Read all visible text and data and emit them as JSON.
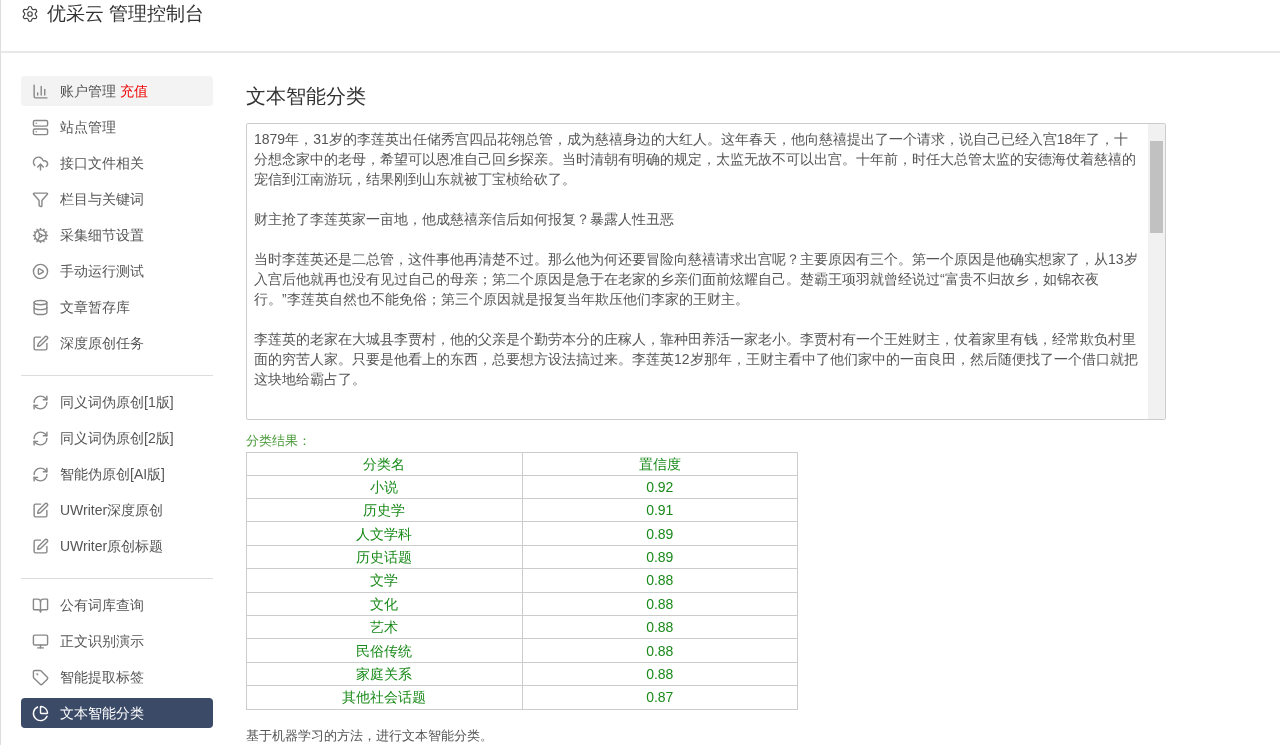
{
  "header": {
    "title": "优采云 管理控制台"
  },
  "sidebar": {
    "groups": [
      {
        "items": [
          {
            "label": "账户管理",
            "tag": "充值",
            "selected": false,
            "highlighted": true
          },
          {
            "label": "站点管理",
            "selected": false,
            "highlighted": false
          },
          {
            "label": "接口文件相关",
            "selected": false,
            "highlighted": false
          },
          {
            "label": "栏目与关键词",
            "selected": false,
            "highlighted": false
          },
          {
            "label": "采集细节设置",
            "selected": false,
            "highlighted": false
          },
          {
            "label": "手动运行测试",
            "selected": false,
            "highlighted": false
          },
          {
            "label": "文章暂存库",
            "selected": false,
            "highlighted": false
          },
          {
            "label": "深度原创任务",
            "selected": false,
            "highlighted": false
          }
        ]
      },
      {
        "items": [
          {
            "label": "同义词伪原创[1版]",
            "selected": false,
            "highlighted": false
          },
          {
            "label": "同义词伪原创[2版]",
            "selected": false,
            "highlighted": false
          },
          {
            "label": "智能伪原创[AI版]",
            "selected": false,
            "highlighted": false
          },
          {
            "label": "UWriter深度原创",
            "selected": false,
            "highlighted": false
          },
          {
            "label": "UWriter原创标题",
            "selected": false,
            "highlighted": false
          }
        ]
      },
      {
        "items": [
          {
            "label": "公有词库查询",
            "selected": false,
            "highlighted": false
          },
          {
            "label": "正文识别演示",
            "selected": false,
            "highlighted": false
          },
          {
            "label": "智能提取标签",
            "selected": false,
            "highlighted": false
          },
          {
            "label": "文本智能分类",
            "selected": true,
            "highlighted": false
          }
        ]
      }
    ]
  },
  "main": {
    "title": "文本智能分类",
    "text_input": {
      "paragraphs": [
        "1879年，31岁的李莲英出任储秀宫四品花翎总管，成为慈禧身边的大红人。这年春天，他向慈禧提出了一个请求，说自己已经入宫18年了，十分想念家中的老母，希望可以恩准自己回乡探亲。当时清朝有明确的规定，太监无故不可以出宫。十年前，时任大总管太监的安德海仗着慈禧的宠信到江南游玩，结果刚到山东就被丁宝桢给砍了。",
        "财主抢了李莲英家一亩地，他成慈禧亲信后如何报复？暴露人性丑恶",
        "当时李莲英还是二总管，这件事他再清楚不过。那么他为何还要冒险向慈禧请求出宫呢？主要原因有三个。第一个原因是他确实想家了，从13岁入宫后他就再也没有见过自己的母亲；第二个原因是急于在老家的乡亲们面前炫耀自己。楚霸王项羽就曾经说过“富贵不归故乡，如锦衣夜行。”李莲英自然也不能免俗；第三个原因就是报复当年欺压他们李家的王财主。",
        "李莲英的老家在大城县李贾村，他的父亲是个勤劳本分的庄稼人，靠种田养活一家老小。李贾村有一个王姓财主，仗着家里有钱，经常欺负村里面的穷苦人家。只要是他看上的东西，总要想方设法搞过来。李莲英12岁那年，王财主看中了他们家中的一亩良田，然后随便找了一个借口就把这块地给霸占了。"
      ]
    },
    "result_label": "分类结果：",
    "table": {
      "columns": [
        "分类名",
        "置信度"
      ],
      "rows": [
        [
          "小说",
          "0.92"
        ],
        [
          "历史学",
          "0.91"
        ],
        [
          "人文学科",
          "0.89"
        ],
        [
          "历史话题",
          "0.89"
        ],
        [
          "文学",
          "0.88"
        ],
        [
          "文化",
          "0.88"
        ],
        [
          "艺术",
          "0.88"
        ],
        [
          "民俗传统",
          "0.88"
        ],
        [
          "家庭关系",
          "0.88"
        ],
        [
          "其他社会话题",
          "0.87"
        ]
      ]
    },
    "note": "基于机器学习的方法，进行文本智能分类。"
  }
}
